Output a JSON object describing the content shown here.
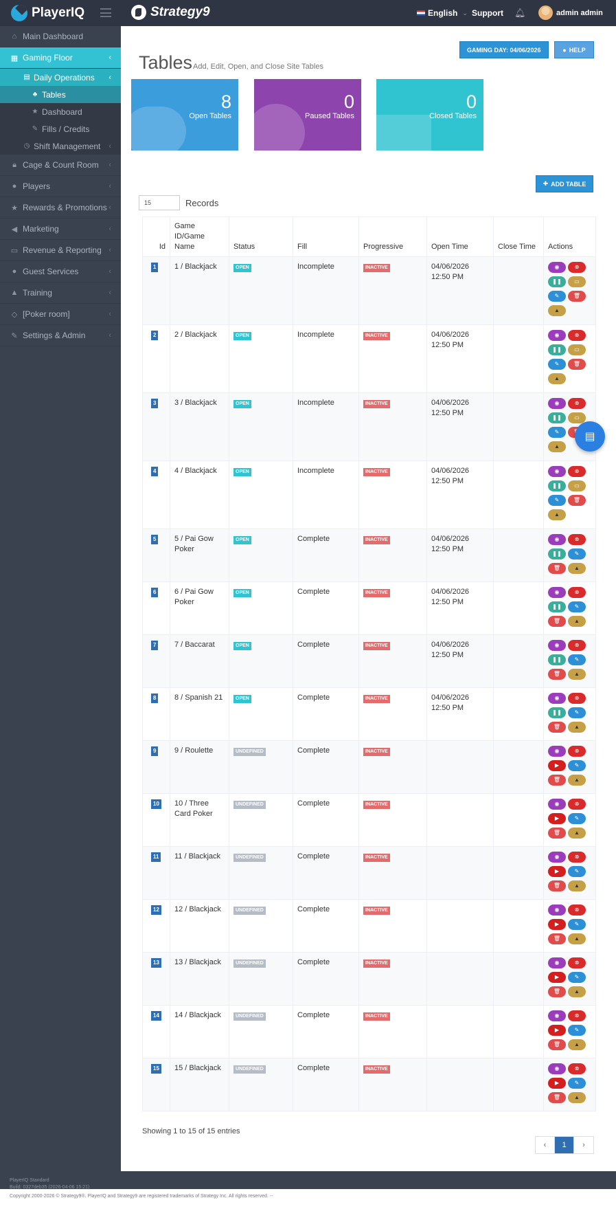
{
  "header": {
    "brand": "PlayerIQ",
    "partner": "Strategy9",
    "language": "English",
    "support": "Support",
    "user": "admin admin"
  },
  "sidebar": {
    "items": [
      {
        "label": "Main Dashboard",
        "icon": "home-icon"
      },
      {
        "label": "Gaming Floor",
        "icon": "table-grid-icon"
      },
      {
        "label": "Cage & Count Room",
        "icon": "lock-icon"
      },
      {
        "label": "Players",
        "icon": "user-icon"
      },
      {
        "label": "Rewards & Promotions",
        "icon": "star-icon"
      },
      {
        "label": "Marketing",
        "icon": "bullhorn-icon"
      },
      {
        "label": "Revenue & Reporting",
        "icon": "money-icon"
      },
      {
        "label": "Guest Services",
        "icon": "users-icon"
      },
      {
        "label": "Training",
        "icon": "graduation-cap-icon"
      },
      {
        "label": "[Poker room]",
        "icon": "diamond-icon"
      },
      {
        "label": "Settings & Admin",
        "icon": "wrench-icon"
      }
    ],
    "gaming_floor_sub": {
      "daily_operations": "Daily Operations",
      "tables": "Tables",
      "dashboard": "Dashboard",
      "fills_credits": "Fills / Credits",
      "shift_management": "Shift Management"
    }
  },
  "page": {
    "title": "Tables",
    "subtitle": "Add, Edit, Open, and Close Site Tables",
    "gaming_day": "GAMING DAY: 04/06/2026",
    "help": "HELP",
    "add_table": "ADD TABLE",
    "records_value": "15",
    "records_label": "Records",
    "showing": "Showing 1 to 15 of 15 entries"
  },
  "tiles": {
    "open": {
      "count": "8",
      "label": "Open Tables"
    },
    "paused": {
      "count": "0",
      "label": "Paused Tables"
    },
    "closed": {
      "count": "0",
      "label": "Closed Tables"
    }
  },
  "table": {
    "headers": [
      "Id",
      "Game ID/Game Name",
      "Status",
      "Fill",
      "Progressive",
      "Open Time",
      "Close Time",
      "Actions"
    ],
    "rows": [
      {
        "id": "1",
        "game": "1 / Blackjack",
        "status": "OPEN",
        "fill": "Incomplete",
        "progressive": "INACTIVE",
        "open_time": "04/06/2026 12:50 PM",
        "close_time": ""
      },
      {
        "id": "2",
        "game": "2 / Blackjack",
        "status": "OPEN",
        "fill": "Incomplete",
        "progressive": "INACTIVE",
        "open_time": "04/06/2026 12:50 PM",
        "close_time": ""
      },
      {
        "id": "3",
        "game": "3 / Blackjack",
        "status": "OPEN",
        "fill": "Incomplete",
        "progressive": "INACTIVE",
        "open_time": "04/06/2026 12:50 PM",
        "close_time": ""
      },
      {
        "id": "4",
        "game": "4 / Blackjack",
        "status": "OPEN",
        "fill": "Incomplete",
        "progressive": "INACTIVE",
        "open_time": "04/06/2026 12:50 PM",
        "close_time": ""
      },
      {
        "id": "5",
        "game": "5 / Pai Gow Poker",
        "status": "OPEN",
        "fill": "Complete",
        "progressive": "INACTIVE",
        "open_time": "04/06/2026 12:50 PM",
        "close_time": ""
      },
      {
        "id": "6",
        "game": "6 / Pai Gow Poker",
        "status": "OPEN",
        "fill": "Complete",
        "progressive": "INACTIVE",
        "open_time": "04/06/2026 12:50 PM",
        "close_time": ""
      },
      {
        "id": "7",
        "game": "7 / Baccarat",
        "status": "OPEN",
        "fill": "Complete",
        "progressive": "INACTIVE",
        "open_time": "04/06/2026 12:50 PM",
        "close_time": ""
      },
      {
        "id": "8",
        "game": "8 / Spanish 21",
        "status": "OPEN",
        "fill": "Complete",
        "progressive": "INACTIVE",
        "open_time": "04/06/2026 12:50 PM",
        "close_time": ""
      },
      {
        "id": "9",
        "game": "9 / Roulette",
        "status": "UNDEFINED",
        "fill": "Complete",
        "progressive": "INACTIVE",
        "open_time": "",
        "close_time": ""
      },
      {
        "id": "10",
        "game": "10 / Three Card Poker",
        "status": "UNDEFINED",
        "fill": "Complete",
        "progressive": "INACTIVE",
        "open_time": "",
        "close_time": ""
      },
      {
        "id": "11",
        "game": "11 / Blackjack",
        "status": "UNDEFINED",
        "fill": "Complete",
        "progressive": "INACTIVE",
        "open_time": "",
        "close_time": ""
      },
      {
        "id": "12",
        "game": "12 / Blackjack",
        "status": "UNDEFINED",
        "fill": "Complete",
        "progressive": "INACTIVE",
        "open_time": "",
        "close_time": ""
      },
      {
        "id": "13",
        "game": "13 / Blackjack",
        "status": "UNDEFINED",
        "fill": "Complete",
        "progressive": "INACTIVE",
        "open_time": "",
        "close_time": ""
      },
      {
        "id": "14",
        "game": "14 / Blackjack",
        "status": "UNDEFINED",
        "fill": "Complete",
        "progressive": "INACTIVE",
        "open_time": "",
        "close_time": ""
      },
      {
        "id": "15",
        "game": "15 / Blackjack",
        "status": "UNDEFINED",
        "fill": "Complete",
        "progressive": "INACTIVE",
        "open_time": "",
        "close_time": ""
      }
    ]
  },
  "pagination": {
    "prev": "‹",
    "current": "1",
    "next": "›"
  },
  "footer": {
    "edition": "PlayerIQ Standard",
    "build": "Build: 0327deb35 (2026-04-06 15:21)",
    "copyright": "Copyright 2000-2026 © Strategy9®. PlayerIQ and Strategy9 are registered trademarks of Strategy Inc. All rights reserved. --"
  }
}
